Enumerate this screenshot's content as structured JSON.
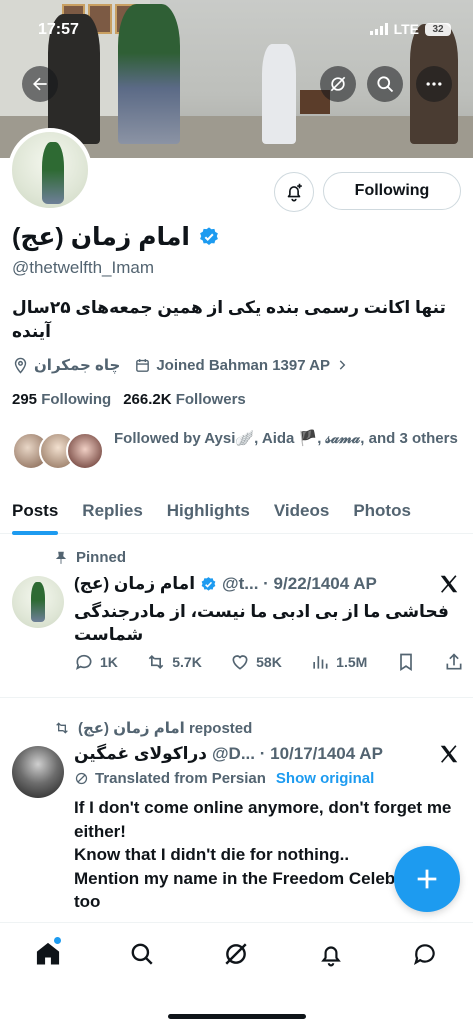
{
  "status_bar": {
    "time": "17:57",
    "network": "LTE",
    "battery": "32"
  },
  "profile": {
    "display_name": "امام زمان (عج)",
    "handle": "@thetwelfth_Imam",
    "bio": "تنها اکانت رسمی بنده یکی از همین جمعه‌های ۲۵سال آینده",
    "location": "چاه جمکران",
    "joined": "Joined Bahman 1397 AP",
    "following_count": "295",
    "following_label": "Following",
    "followers_count": "266.2K",
    "followers_label": "Followers",
    "followed_by": "Followed by Aysi🪽, Aida 🏴, 𝓈𝒶𝓂𝒶, and 3 others",
    "follow_button": "Following"
  },
  "tabs": [
    "Posts",
    "Replies",
    "Highlights",
    "Videos",
    "Photos"
  ],
  "active_tab": "Posts",
  "posts": [
    {
      "context": "Pinned",
      "name": "امام زمان (عج)",
      "meta": "@t... · 9/22/1404 AP",
      "text": "فحاشی ما از بی ادبی ما نیست، از مادرجندگی شماست",
      "replies": "1K",
      "reposts": "5.7K",
      "likes": "58K",
      "views": "1.5M"
    },
    {
      "context": "امام زمان (عج) reposted",
      "name": "دراکولای غمگین",
      "meta": "@D... · 10/17/1404 AP",
      "translated_label": "Translated from Persian",
      "show_original": "Show original",
      "text": "If I don't come online anymore, don't forget me either!\nKnow that I didn't die for nothing..\nMention my name in the Freedom Celebration too"
    }
  ],
  "colors": {
    "accent": "#1d9bf0",
    "text": "#0f1419",
    "secondary": "#536471"
  },
  "icons": {
    "header": [
      "back-arrow-icon",
      "grok-icon",
      "search-icon",
      "more-icon"
    ],
    "nav": [
      "home-icon",
      "search-icon",
      "grok-icon",
      "notifications-icon",
      "messages-icon"
    ]
  }
}
